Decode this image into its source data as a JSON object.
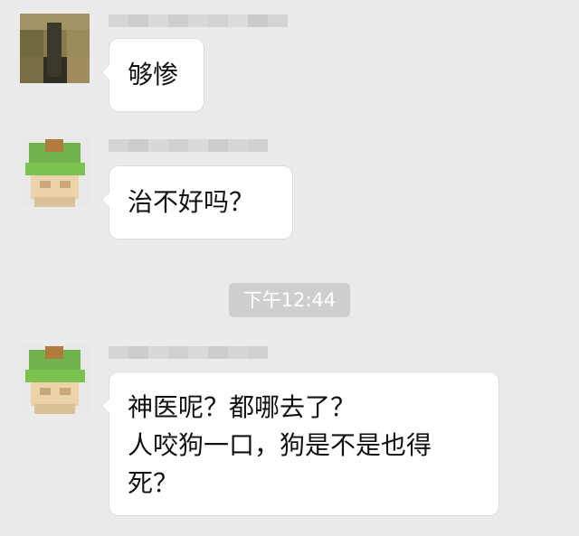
{
  "colors": {
    "background": "#ebebeb",
    "bubble": "#ffffff",
    "timestamp_pill": "#cfcfcf"
  },
  "messages": [
    {
      "avatar": "blurred-photo-avatar",
      "text_lines": [
        "够惨"
      ]
    },
    {
      "avatar": "blurred-green-cartoon-avatar",
      "text_lines": [
        "治不好吗？"
      ]
    },
    {
      "avatar": "blurred-green-cartoon-avatar",
      "text_lines": [
        "神医呢？都哪去了？",
        "人咬狗一口，狗是不是也得",
        "死？"
      ]
    }
  ],
  "timestamp": "下午12:44"
}
